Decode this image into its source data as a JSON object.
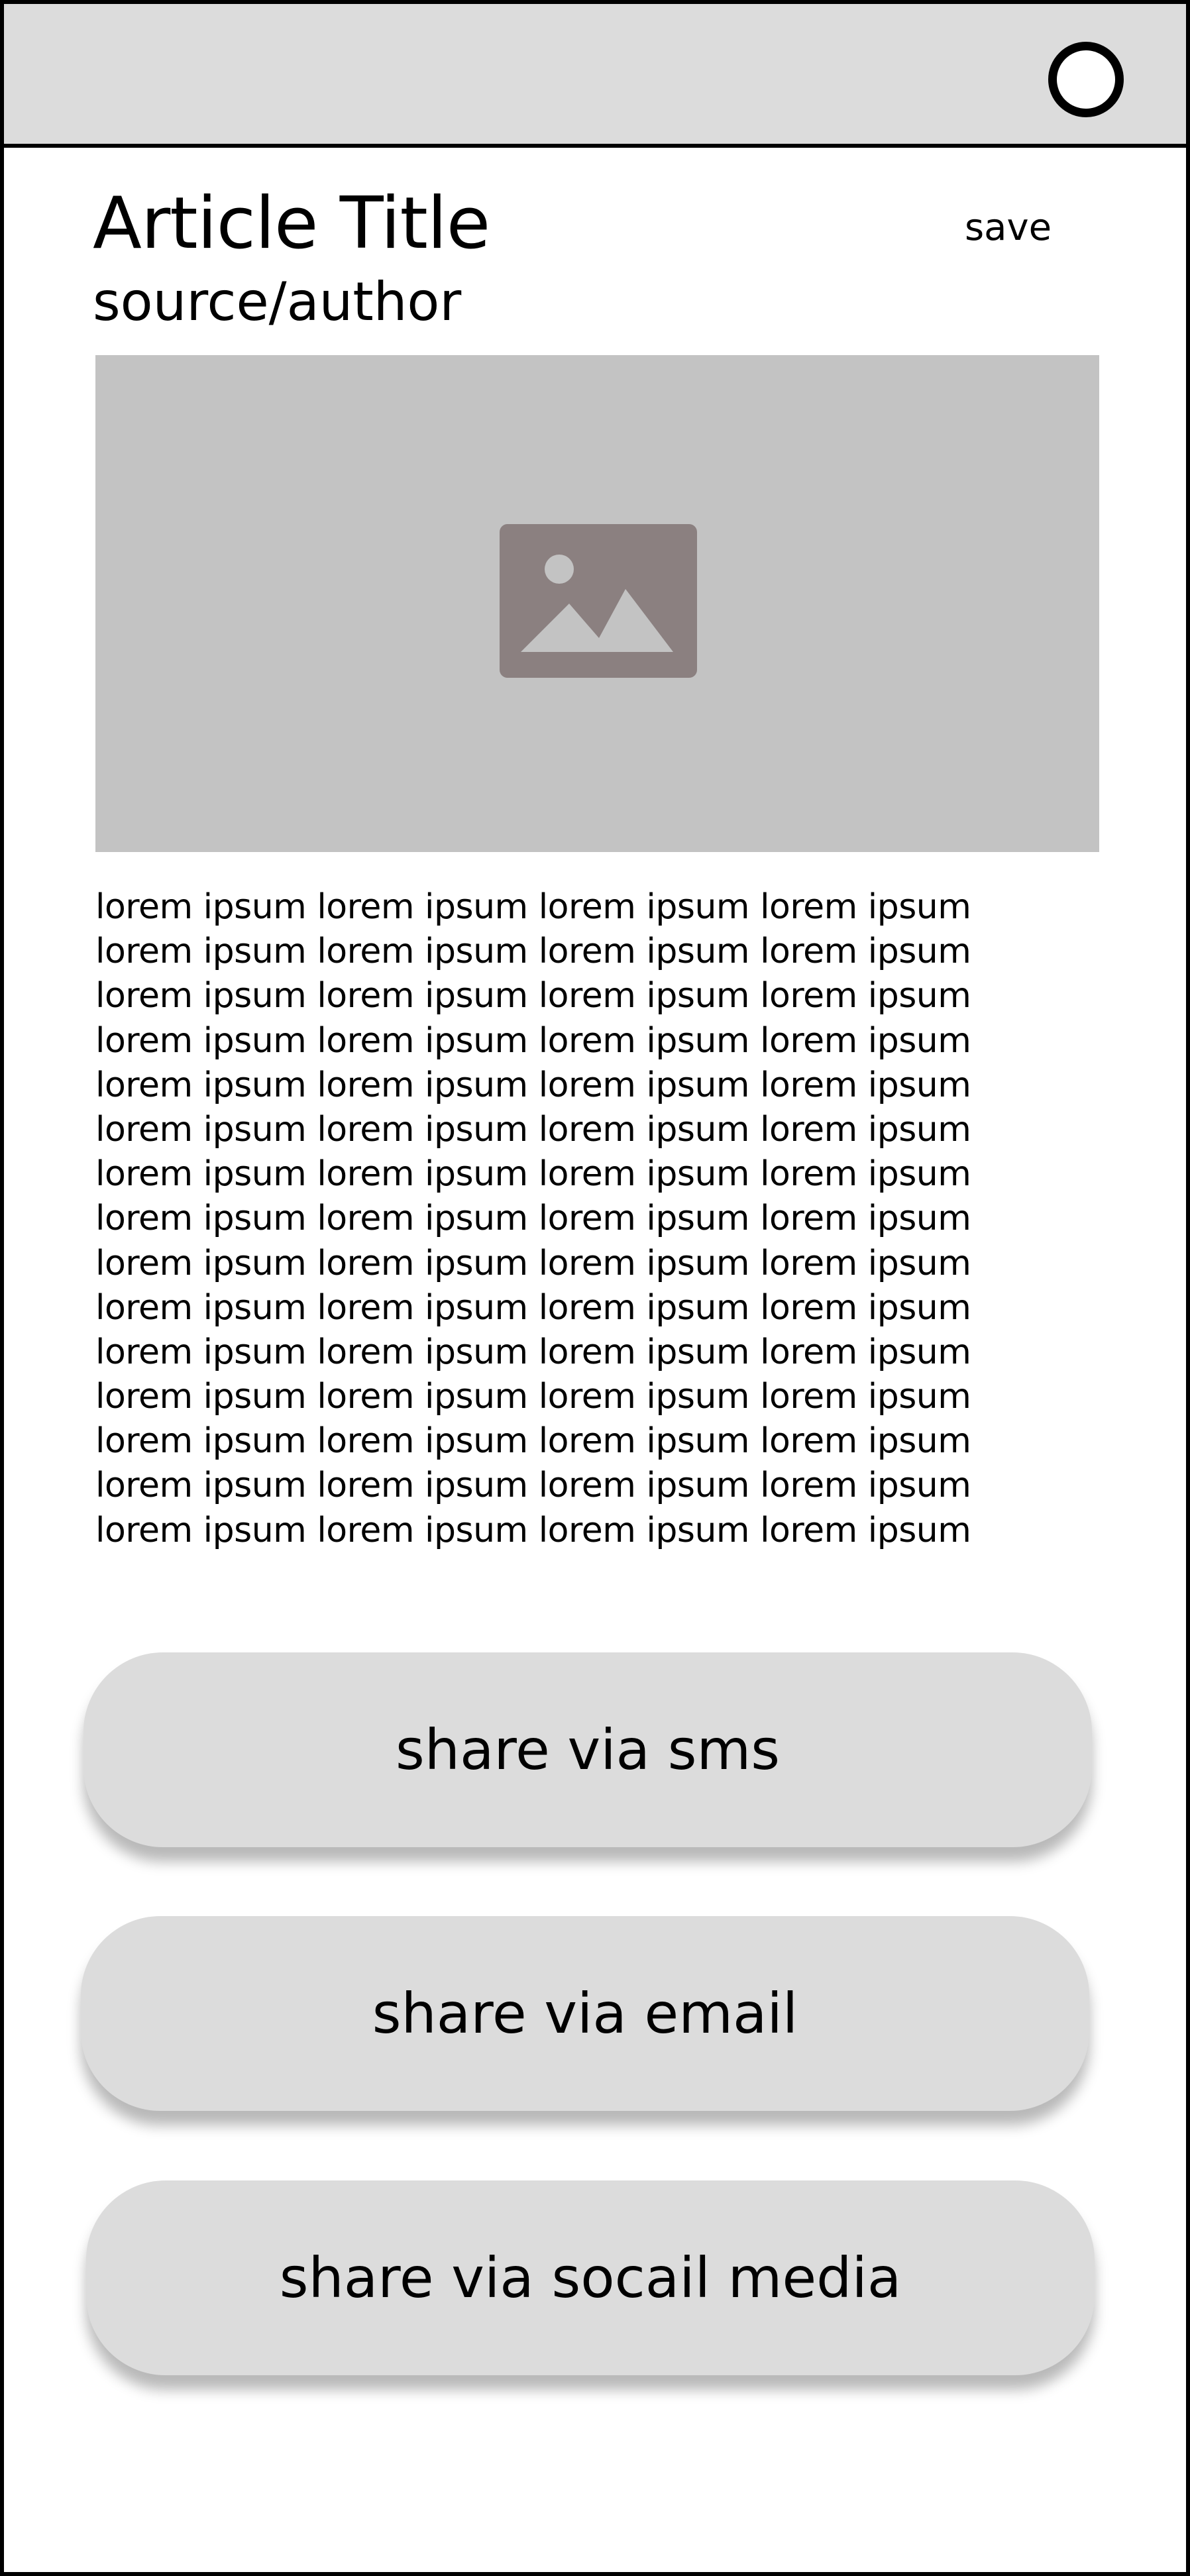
{
  "header": {
    "menu_icon": "circle-icon"
  },
  "article": {
    "title": "Article Title",
    "source": "source/author",
    "save_label": "save",
    "image_icon": "image-placeholder-icon",
    "body_lines": [
      "lorem ipsum lorem ipsum lorem ipsum lorem ipsum",
      "lorem ipsum lorem ipsum lorem ipsum lorem ipsum",
      "lorem ipsum lorem ipsum lorem ipsum lorem ipsum",
      "lorem ipsum lorem ipsum lorem ipsum lorem ipsum",
      "lorem ipsum lorem ipsum lorem ipsum lorem ipsum",
      "lorem ipsum lorem ipsum lorem ipsum lorem ipsum",
      "lorem ipsum lorem ipsum lorem ipsum lorem ipsum",
      "lorem ipsum lorem ipsum lorem ipsum lorem ipsum",
      "lorem ipsum lorem ipsum lorem ipsum lorem ipsum",
      "lorem ipsum lorem ipsum lorem ipsum lorem ipsum",
      "lorem ipsum lorem ipsum lorem ipsum lorem ipsum",
      "lorem ipsum lorem ipsum lorem ipsum lorem ipsum",
      "lorem ipsum lorem ipsum lorem ipsum lorem ipsum",
      "lorem ipsum lorem ipsum lorem ipsum lorem ipsum",
      "lorem ipsum lorem ipsum lorem ipsum lorem ipsum"
    ]
  },
  "share": {
    "sms_label": "share via sms",
    "email_label": "share via email",
    "social_label": "share via socail media"
  },
  "colors": {
    "topbar": "#dcdcdc",
    "image_bg": "#c3c3c3",
    "image_icon": "#8b8080",
    "button_bg": "#dcdcdc",
    "border": "#000000"
  }
}
